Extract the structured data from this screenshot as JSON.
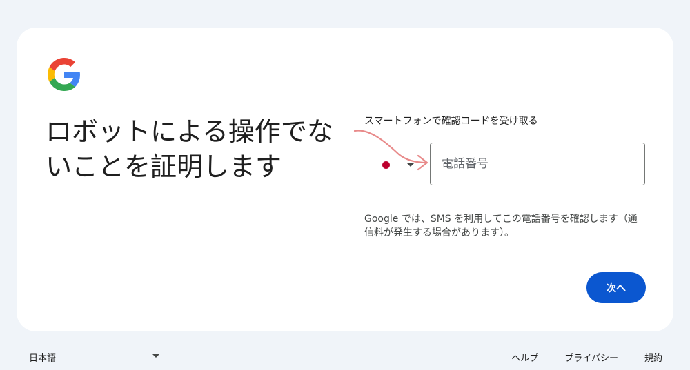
{
  "brand": {
    "logo_icon": "google-g-icon",
    "colors": [
      "#4285f4",
      "#ea4335",
      "#fbbc05",
      "#34a853"
    ]
  },
  "main": {
    "headline": "ロボットによる操作でないことを証明します",
    "phone_label": "スマートフォンで確認コードを受け取る",
    "country_flag": "japan-flag-icon",
    "phone_placeholder": "電話番号",
    "notice": "Google では、SMS を利用してこの電話番号を確認します（通信料が発生する場合があります）。",
    "next_label": "次へ",
    "accent_color": "#0b57d0"
  },
  "annotation": {
    "arrow_color": "#e88a8a"
  },
  "footer": {
    "language": "日本語",
    "links": [
      "ヘルプ",
      "プライバシー",
      "規約"
    ]
  }
}
